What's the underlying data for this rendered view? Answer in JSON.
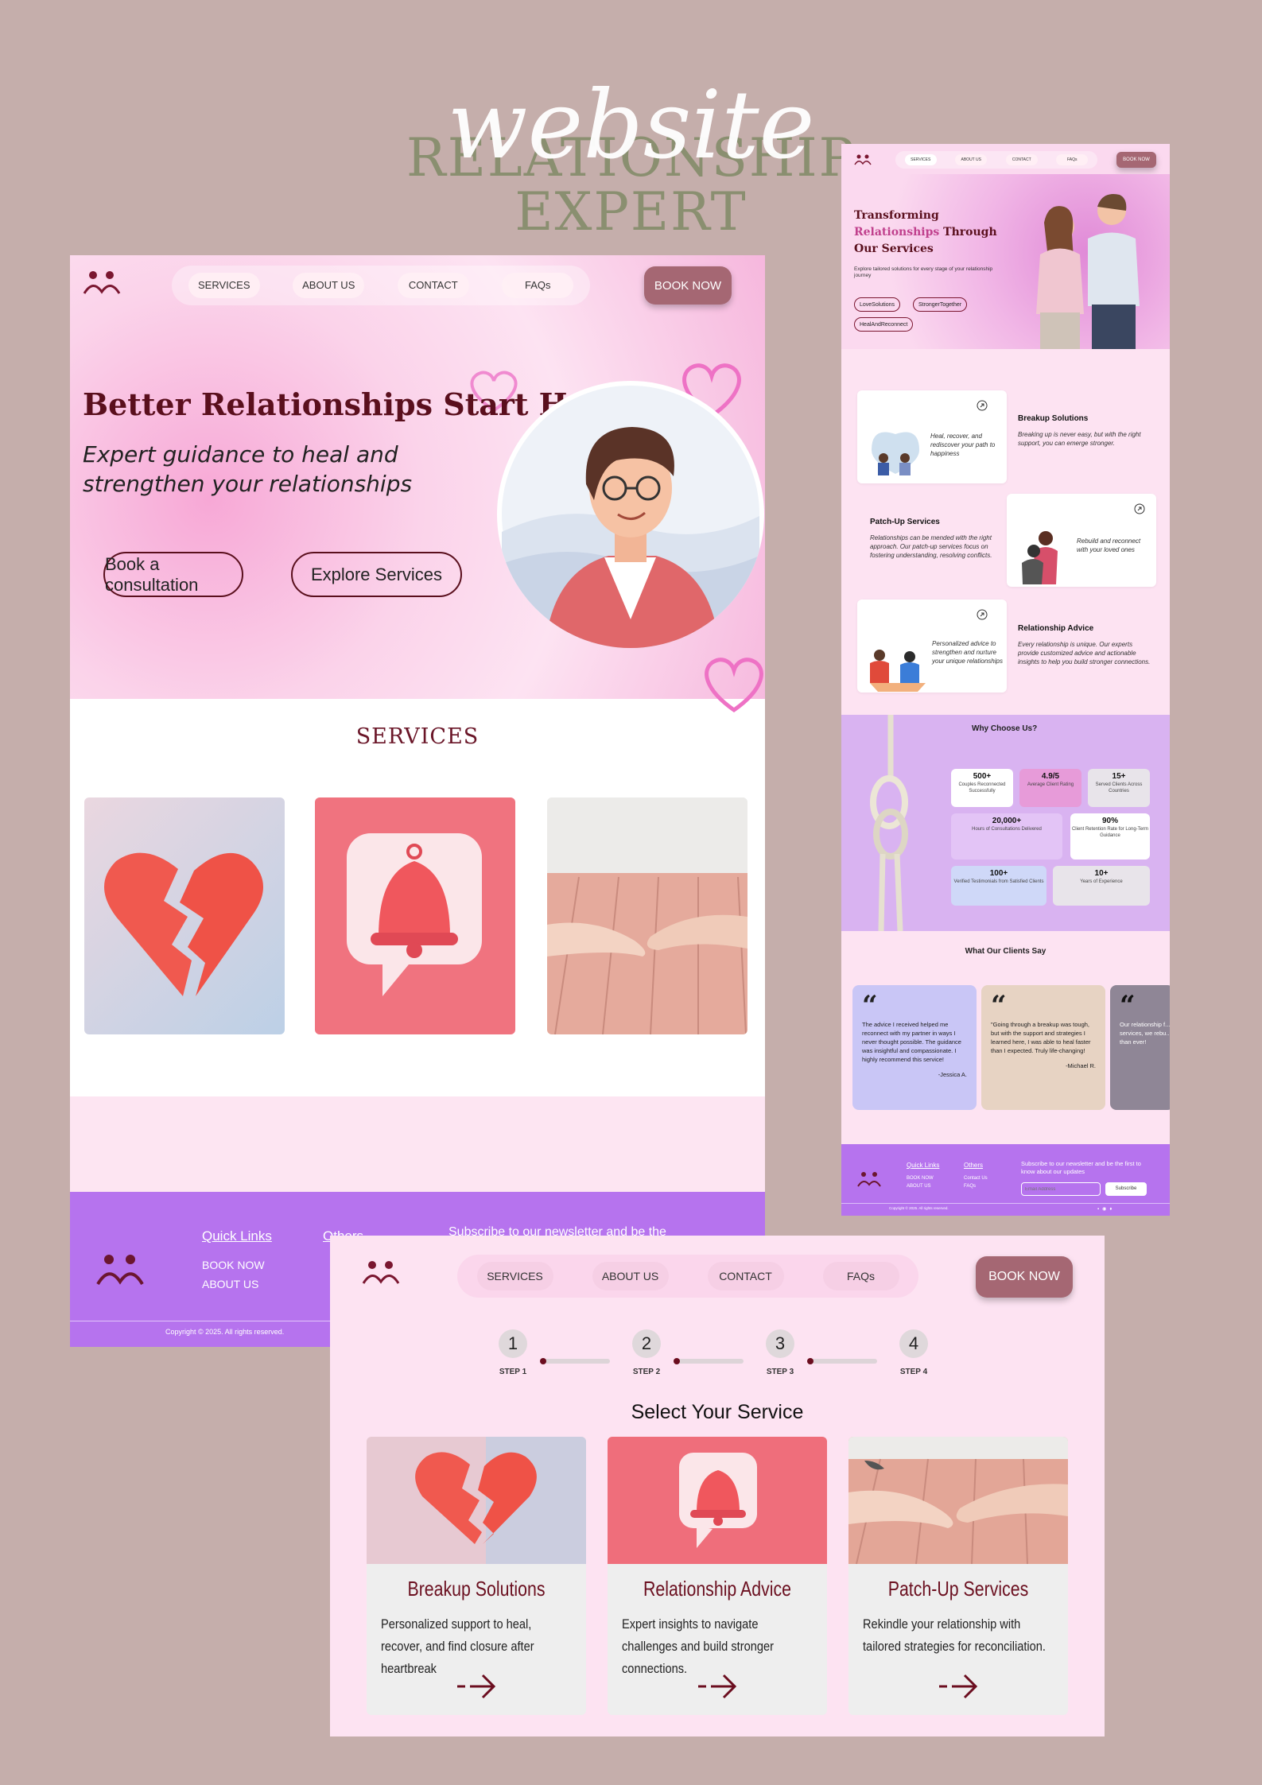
{
  "mockup": {
    "script_word": "website",
    "title_line1": "RELATIONSHIP",
    "title_line2": "EXPERT"
  },
  "colors": {
    "background": "#c5aeab",
    "title_green": "#8a8f70",
    "accent_maroon": "#5a0f1d",
    "book_button": "#a56773",
    "footer_purple": "#b673ee",
    "pink": "#fde3f2"
  },
  "nav": {
    "services": "SERVICES",
    "about": "ABOUT US",
    "contact": "CONTACT",
    "faqs": "FAQs",
    "book": "BOOK NOW"
  },
  "home": {
    "hero_title": "Better Relationships Start Here",
    "hero_subtitle": "Expert guidance to heal and strengthen your relationships",
    "btn_consult": "Book a consultation",
    "btn_explore": "Explore Services",
    "services_heading": "SERVICES",
    "footer": {
      "quick_links": "Quick Links",
      "others": "Others",
      "book_now": "BOOK NOW",
      "about_us": "ABOUT US",
      "subscribe": "Subscribe to our newsletter and be the",
      "copyright": "Copyright © 2025. All rights reserved."
    }
  },
  "services_page": {
    "hero_title_1": "Transforming",
    "hero_title_2": "Relationships",
    "hero_title_3": "Through",
    "hero_title_4": "Our Services",
    "hero_desc": "Explore tailored solutions for every stage of your relationship journey",
    "tags": [
      "LoveSolutions",
      "StrongerTogether",
      "HealAndReconnect"
    ],
    "cards": [
      {
        "title": "Breakup Solutions",
        "desc": "Breaking up is never easy, but with the right support, you can emerge stronger.",
        "img_caption": "Heal, recover, and rediscover your path to happiness"
      },
      {
        "title": "Patch-Up Services",
        "desc": "Relationships can be mended with the right approach. Our patch-up services focus on fostering understanding, resolving conflicts.",
        "img_caption": "Rebuild and reconnect with your loved ones"
      },
      {
        "title": "Relationship Advice",
        "desc": "Every relationship is unique. Our experts provide customized advice and actionable insights to help you build stronger connections.",
        "img_caption": "Personalized advice to strengthen and nurture your unique relationships"
      }
    ],
    "why_title": "Why Choose Us?",
    "stats": [
      {
        "value": "500+",
        "label": "Couples Reconnected Successfully"
      },
      {
        "value": "4.9/5",
        "label": "Average Client Rating"
      },
      {
        "value": "15+",
        "label": "Served Clients Across Countries"
      },
      {
        "value": "20,000+",
        "label": "Hours of Consultations Delivered"
      },
      {
        "value": "90%",
        "label": "Client Retention Rate for Long-Term Guidance"
      },
      {
        "value": "100+",
        "label": "Verified Testimonials from Satisfied Clients"
      },
      {
        "value": "10+",
        "label": "Years of Experience"
      }
    ],
    "clients_title": "What Our Clients Say",
    "testimonials": [
      {
        "text": "The advice I received helped me reconnect with my partner in ways I never thought possible. The guidance was insightful and compassionate. I highly recommend this service!",
        "author": "-Jessica A."
      },
      {
        "text": "\"Going through a breakup was tough, but with the support and strategies I learned here, I was able to heal faster than I expected. Truly life-changing!",
        "author": "-Michael R."
      },
      {
        "text": "Our relationship f... but with the help... services, we rebu... communication... than ever!",
        "author": ""
      }
    ],
    "footer": {
      "quick_links": "Quick Links",
      "others": "Others",
      "book_now": "BOOK NOW",
      "about_us": "ABOUT US",
      "contact_us": "Contact Us",
      "faqs": "FAQs",
      "subscribe": "Subscribe to our newsletter and be the first to know about our updates",
      "email_placeholder": "Email Address",
      "subscribe_btn": "Subscribe",
      "copyright": "Copyright © 2025. All rights reserved."
    }
  },
  "booking_page": {
    "steps": [
      {
        "num": "1",
        "label": "STEP 1"
      },
      {
        "num": "2",
        "label": "STEP 2"
      },
      {
        "num": "3",
        "label": "STEP 3"
      },
      {
        "num": "4",
        "label": "STEP 4"
      }
    ],
    "heading": "Select Your Service",
    "cards": [
      {
        "title": "Breakup Solutions",
        "desc": "Personalized support to heal, recover, and find closure after heartbreak"
      },
      {
        "title": "Relationship Advice",
        "desc": "Expert insights to navigate challenges and build stronger connections."
      },
      {
        "title": "Patch-Up Services",
        "desc": "Rekindle your relationship with tailored strategies for reconciliation."
      }
    ]
  }
}
